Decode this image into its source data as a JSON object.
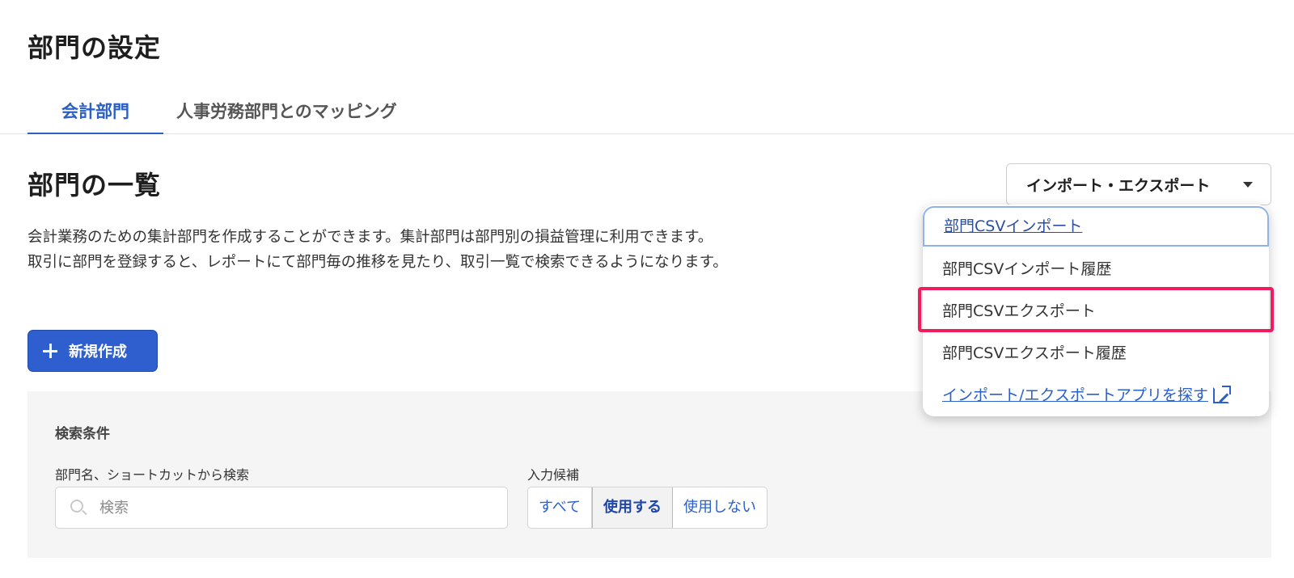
{
  "page": {
    "title": "部門の設定"
  },
  "tabs": [
    {
      "label": "会計部門",
      "active": true
    },
    {
      "label": "人事労務部門とのマッピング",
      "active": false
    }
  ],
  "section": {
    "title": "部門の一覧",
    "description": [
      "会計業務のための集計部門を作成することができます。集計部門は部門別の損益管理に利用できます。",
      "取引に部門を登録すると、レポートにて部門毎の推移を見たり、取引一覧で検索できるようになります。"
    ]
  },
  "import_export": {
    "button_label": "インポート・エクスポート",
    "icon": "chevron-down-icon",
    "menu": [
      {
        "label": "部門CSVインポート"
      },
      {
        "label": "部門CSVインポート履歴"
      },
      {
        "label": "部門CSVエクスポート",
        "highlighted": true
      },
      {
        "label": "部門CSVエクスポート履歴"
      },
      {
        "label": "インポート/エクスポートアプリを探す",
        "icon": "external-link-icon"
      }
    ]
  },
  "new_button": {
    "label": "新規作成",
    "icon": "plus-icon"
  },
  "search": {
    "title": "検索条件",
    "name_label": "部門名、ショートカットから検索",
    "placeholder": "検索",
    "candidate_label": "入力候補",
    "candidate_options": [
      {
        "label": "すべて",
        "selected": false
      },
      {
        "label": "使用する",
        "selected": true
      },
      {
        "label": "使用しない",
        "selected": false
      }
    ]
  },
  "colors": {
    "accent": "#2a60c8",
    "primary_button": "#2f5fcf",
    "highlight": "#ef1d5e",
    "panel_bg": "#f6f5f5"
  }
}
